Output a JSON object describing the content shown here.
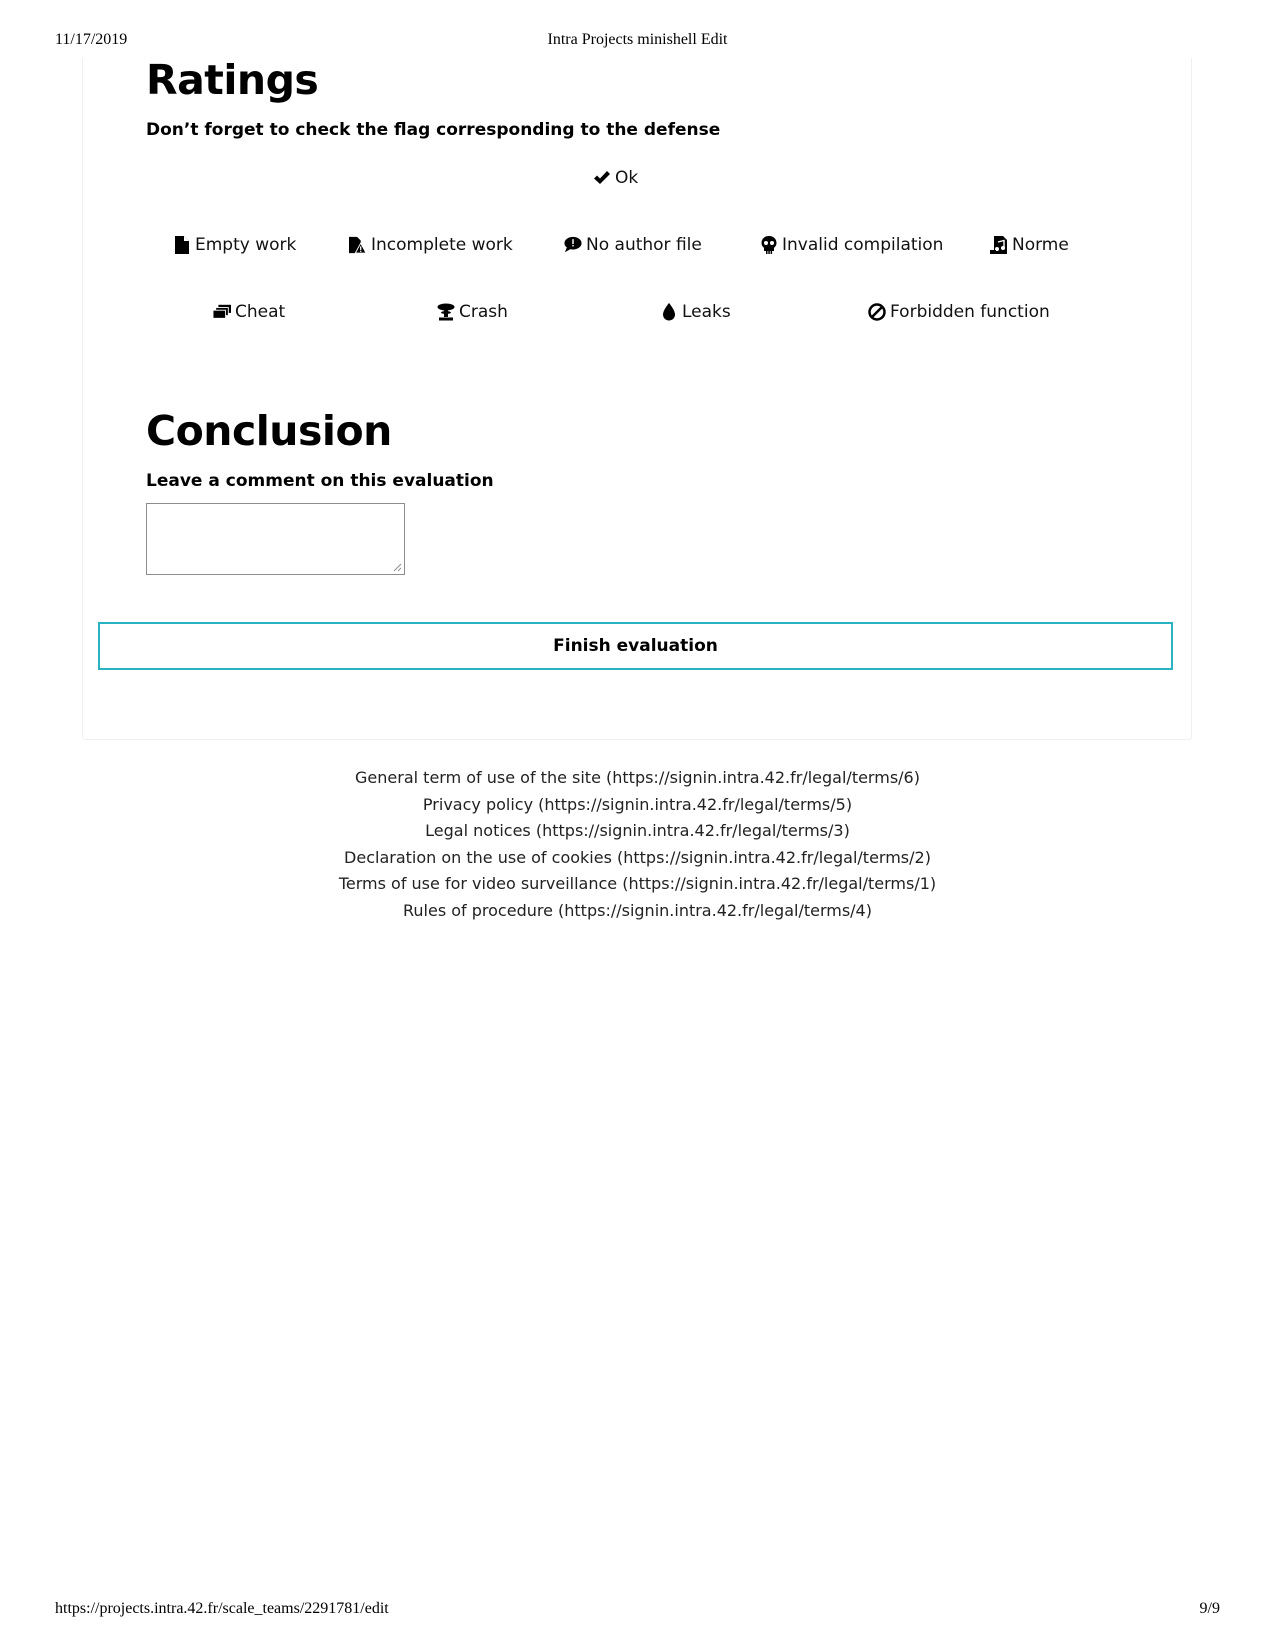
{
  "print_header": {
    "date": "11/17/2019",
    "title": "Intra Projects minishell Edit"
  },
  "print_footer": {
    "url": "https://projects.intra.42.fr/scale_teams/2291781/edit",
    "page": "9/9"
  },
  "ratings": {
    "title": "Ratings",
    "subtitle": "Don’t forget to check the flag corresponding to the defense",
    "ok_flag": {
      "label": "Ok",
      "icon": "check-icon"
    },
    "flags_row1": [
      {
        "label": "Empty work",
        "icon": "file-icon"
      },
      {
        "label": "Incomplete work",
        "icon": "file-warning-icon"
      },
      {
        "label": "No author file",
        "icon": "comment-alert-icon"
      },
      {
        "label": "Invalid compilation",
        "icon": "skull-icon"
      },
      {
        "label": "Norme",
        "icon": "file-music-icon"
      }
    ],
    "flags_row2": [
      {
        "label": "Cheat",
        "icon": "stacked-cards-icon"
      },
      {
        "label": "Crash",
        "icon": "mushroom-cloud-icon"
      },
      {
        "label": "Leaks",
        "icon": "drop-icon"
      },
      {
        "label": "Forbidden function",
        "icon": "ban-icon"
      }
    ]
  },
  "conclusion": {
    "title": "Conclusion",
    "comment_label": "Leave a comment on this evaluation",
    "comment_value": ""
  },
  "finish_button": {
    "label": "Finish evaluation",
    "border_color": "#29b3c2"
  },
  "footer_links": [
    "General term of use of the site (https://signin.intra.42.fr/legal/terms/6)",
    "Privacy policy (https://signin.intra.42.fr/legal/terms/5)",
    "Legal notices (https://signin.intra.42.fr/legal/terms/3)",
    "Declaration on the use of cookies (https://signin.intra.42.fr/legal/terms/2)",
    "Terms of use for video surveillance (https://signin.intra.42.fr/legal/terms/1)",
    "Rules of procedure (https://signin.intra.42.fr/legal/terms/4)"
  ]
}
